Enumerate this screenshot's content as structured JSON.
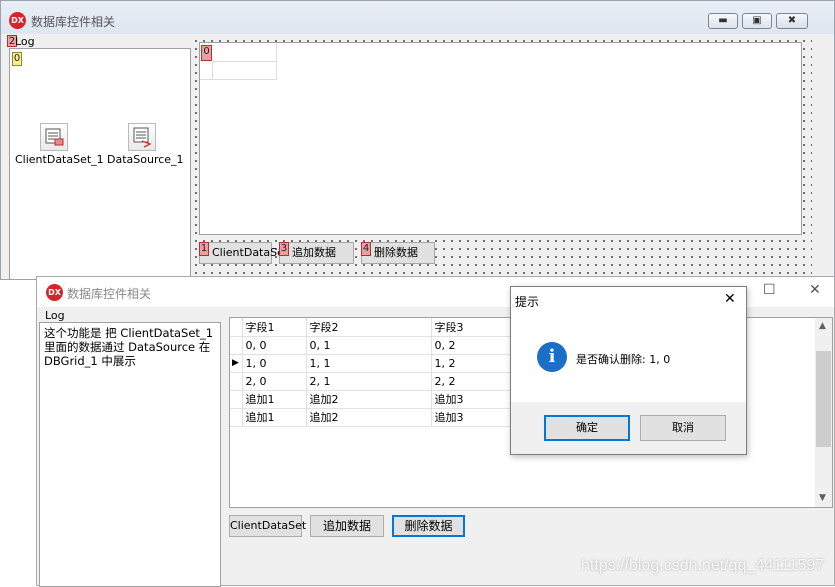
{
  "ide": {
    "title": "数据库控件相关",
    "logo": "DX",
    "log_label": "Log",
    "log_label_tag": "2",
    "memo_tag": "0",
    "grid_tag": "0",
    "components": [
      {
        "label": "ClientDataSet_1",
        "icon": "clientdataset-icon"
      },
      {
        "label": "DataSource_1",
        "icon": "datasource-icon"
      }
    ],
    "buttons": [
      {
        "tag": "1",
        "label": "ClientDataSet"
      },
      {
        "tag": "3",
        "label": "追加数据"
      },
      {
        "tag": "4",
        "label": "删除数据"
      }
    ],
    "window_controls": [
      "minimize",
      "maximize",
      "close"
    ]
  },
  "runtime": {
    "title": "数据库控件相关",
    "logo": "DX",
    "log_label": "Log",
    "log_text": "这个功能是 把 ClientDataSet_1 里面的数据通过 DataSource 在 DBGrid_1 中展示",
    "grid": {
      "columns": [
        "字段1",
        "字段2",
        "字段3"
      ],
      "rows": [
        [
          "0, 0",
          "0, 1",
          "0, 2"
        ],
        [
          "1, 0",
          "1, 1",
          "1, 2"
        ],
        [
          "2, 0",
          "2, 1",
          "2, 2"
        ],
        [
          "追加1",
          "追加2",
          "追加3"
        ],
        [
          "追加1",
          "追加2",
          "追加3"
        ]
      ],
      "current_row": 1,
      "row_indicator": "▶"
    },
    "buttons": {
      "clientdataset": "ClientDataSet",
      "append": "追加数据",
      "delete": "删除数据"
    },
    "controls": {
      "maximize": "☐",
      "close": "✕"
    }
  },
  "dialog": {
    "title": "提示",
    "close": "✕",
    "icon": "info-icon",
    "icon_glyph": "i",
    "message": "是否确认删除: 1, 0",
    "ok": "确定",
    "cancel": "取消"
  },
  "watermark": "https://blog.csdn.net/qq_44111597",
  "colors": {
    "accent": "#0078d7",
    "logo": "#d8232a",
    "info": "#1b6fc6"
  }
}
